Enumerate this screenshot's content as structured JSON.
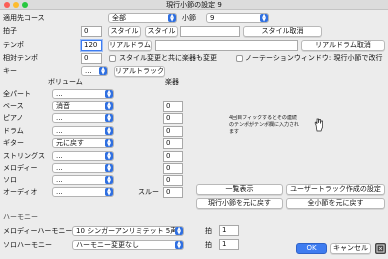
{
  "window": {
    "title": "現行小節の設定 9"
  },
  "fields": {
    "apply_course_label": "適用先コース",
    "apply_course_value": "全部",
    "measure_label": "小節",
    "measure_value": "9",
    "time_sig_label": "拍子",
    "time_sig_value": "0",
    "style_button_1": "スタイル",
    "style_button_2": "スタイル",
    "style_cancel": "スタイル取消",
    "tempo_label": "テンポ",
    "tempo_value": "120",
    "realdrum_button": "リアルドラム",
    "realdrum_cancel": "リアルドラム取消",
    "relative_tempo_label": "相対テンポ",
    "relative_tempo_value": "0",
    "style_change_checkbox": "スタイル変更と共に楽器も変更",
    "notation_checkbox": "ノーテーションウィンドウ: 現行小節で改行",
    "key_label": "キー",
    "key_value": "...",
    "realtrack_button": "リアルトラック"
  },
  "parts": {
    "volume_header": "ボリューム",
    "instrument_header": "楽器",
    "rows": [
      {
        "label": "全パート",
        "volume": "...",
        "instrument": ""
      },
      {
        "label": "ベース",
        "volume": "消音",
        "instrument": "0"
      },
      {
        "label": "ピアノ",
        "volume": "...",
        "instrument": "0"
      },
      {
        "label": "ドラム",
        "volume": "...",
        "instrument": "0"
      },
      {
        "label": "ギター",
        "volume": "元に戻す",
        "instrument": "0"
      },
      {
        "label": "ストリングス",
        "volume": "...",
        "instrument": "0"
      },
      {
        "label": "メロディー",
        "volume": "...",
        "instrument": "0"
      },
      {
        "label": "ソロ",
        "volume": "...",
        "instrument": "0"
      },
      {
        "label": "オーディオ",
        "volume": "...",
        "instrument": ""
      }
    ],
    "slur_label": "スルー",
    "slur_value": "0"
  },
  "note_box": {
    "text": "4回目フィックするとその連続のテンポがテンポ欄に入力されます"
  },
  "actions": {
    "list_button": "一覧表示",
    "user_track_button": "ユーザートラック作成の設定",
    "reset_current_button": "現行小節を元に戻す",
    "reset_all_button": "全小節を元に戻す"
  },
  "harmony": {
    "section_label": "ハーモニー",
    "melody_label": "メロディーハーモニー",
    "melody_value": "10 シンガーアンリミテット 5声",
    "solo_label": "ソロハーモニー",
    "solo_value": "ハーモニー変更なし",
    "beat_label_1": "拍",
    "beat_value_1": "1",
    "beat_label_2": "拍",
    "beat_value_2": "1"
  },
  "footer": {
    "ok": "OK",
    "cancel": "キャンセル"
  }
}
